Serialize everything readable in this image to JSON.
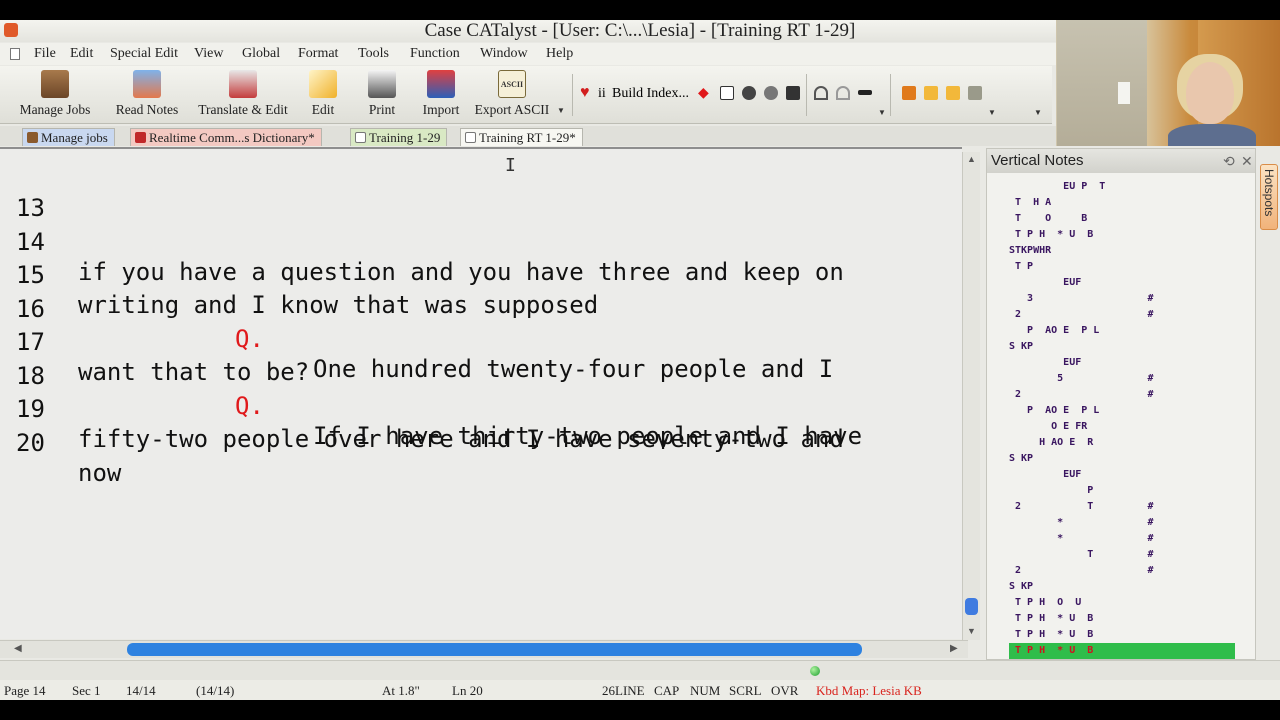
{
  "window": {
    "title": "Case CATalyst - [User: C:\\...\\Lesia] - [Training RT 1-29]"
  },
  "menu": [
    "File",
    "Edit",
    "Special Edit",
    "View",
    "Global",
    "Format",
    "Tools",
    "Function",
    "Window",
    "Help"
  ],
  "toolbar": {
    "manage_jobs": "Manage Jobs",
    "read_notes": "Read Notes",
    "translate_edit": "Translate & Edit",
    "edit": "Edit",
    "print": "Print",
    "import": "Import",
    "export_ascii": "Export ASCII",
    "export_icon_text": "ASCII",
    "ii": "ii",
    "build_index": "Build Index..."
  },
  "tabs": [
    {
      "label": "Manage jobs"
    },
    {
      "label": "Realtime Comm...s Dictionary*"
    },
    {
      "label": "Training 1-29"
    },
    {
      "label": "Training RT 1-29*"
    }
  ],
  "editor": {
    "lines": [
      {
        "num": "13",
        "q": "",
        "text": ""
      },
      {
        "num": "14",
        "q": "",
        "text": "if you have a question and you have three and keep on"
      },
      {
        "num": "15",
        "q": "",
        "text": "writing and I know that was supposed"
      },
      {
        "num": "16",
        "q": "Q.",
        "text": "One hundred twenty-four people and I"
      },
      {
        "num": "17",
        "q": "",
        "text": "want that to be?"
      },
      {
        "num": "18",
        "q": "Q.",
        "text": "If I have thirty-two people and I have"
      },
      {
        "num": "19",
        "q": "",
        "text": "fifty-two people over here and I have seventy-two and"
      },
      {
        "num": "20",
        "q": "",
        "text": "now"
      }
    ]
  },
  "vertical_notes": {
    "title": "Vertical Notes",
    "rows": [
      "         EU P  T",
      " T  H A",
      " T    O     B",
      " T P H  * U  B",
      "STKPWHR",
      " T P",
      "         EUF",
      "   3                   #",
      " 2                     #",
      "   P  AO E  P L",
      "S KP",
      "         EUF",
      "        5              #",
      " 2                     #",
      "   P  AO E  P L",
      "       O E FR",
      "     H AO E  R",
      "S KP",
      "         EUF",
      "             P",
      " 2           T         #",
      "        *              #",
      "        *              #",
      "             T         #",
      " 2                     #",
      "S KP",
      " T P H  O  U",
      " T P H  * U  B",
      " T P H  * U  B",
      " T P H  * U  B"
    ]
  },
  "hotspots": "Hotspots",
  "status": {
    "page": "Page 14",
    "sec": "Sec 1",
    "pos": "14/14",
    "pos2": "(14/14)",
    "at": "At 1.8\"",
    "ln": "Ln 20",
    "lines": "26LINE",
    "cap": "CAP",
    "num": "NUM",
    "scrl": "SCRL",
    "ovr": "OVR",
    "kbd": "Kbd Map: Lesia KB"
  },
  "colors": {
    "q_label": "#e0191b",
    "kbd_map": "#d9241e",
    "steno_text": "#3a1660",
    "highlight_row": "#2fbd4a",
    "scroll_thumb": "#2e82e0"
  }
}
